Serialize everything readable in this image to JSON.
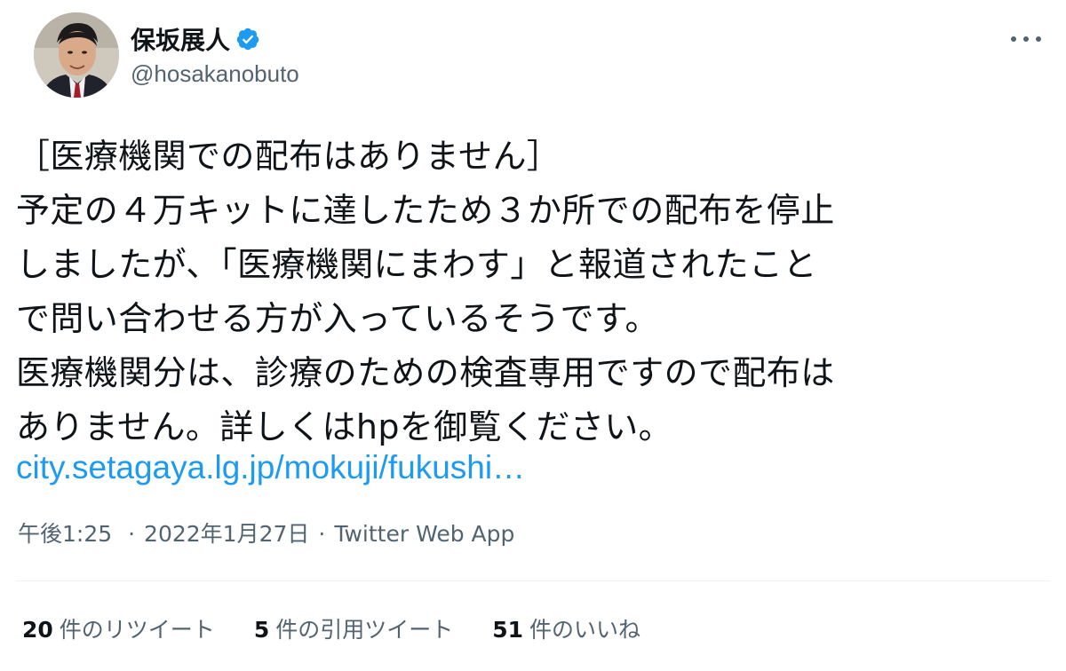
{
  "author": {
    "display_name": "保坂展人",
    "handle": "@hosakanobuto",
    "verified_icon": "verified-badge-icon",
    "verified_color": "#1d9bf0"
  },
  "tweet": {
    "lines": [
      "［医療機関での配布はありません］",
      "予定の４万キットに達したため３か所での配布を停止",
      "しましたが、「医療機関にまわす」と報道されたこと",
      "で問い合わせる方が入っているそうです。",
      "医療機関分は、診療のための検査専用ですので配布は",
      "ありません。詳しくはhpを御覧ください。"
    ],
    "link_text": "city.setagaya.lg.jp/mokuji/fukushi…",
    "link_color": "#1d9bf0"
  },
  "meta": {
    "time": "午後1:25",
    "separator": "·",
    "date": "2022年1月27日",
    "source": "Twitter Web App"
  },
  "stats": {
    "retweets": {
      "count": "20",
      "label": "件のリツイート"
    },
    "quotes": {
      "count": "5",
      "label": "件の引用ツイート"
    },
    "likes": {
      "count": "51",
      "label": "件のいいね"
    }
  },
  "colors": {
    "text_primary": "#0f1419",
    "text_secondary": "#536471",
    "divider": "#eff3f4"
  }
}
